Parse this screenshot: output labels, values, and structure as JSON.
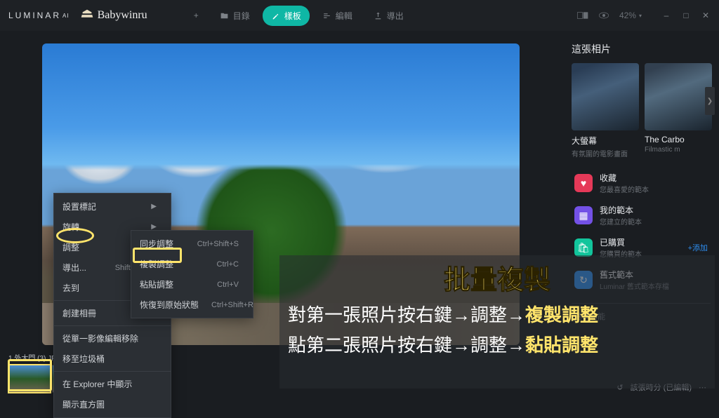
{
  "header": {
    "brand": "LUMINAR",
    "brand_sup": "AI",
    "annotation_signature": "Babywinru",
    "nav": {
      "add": "+",
      "catalog": "目錄",
      "templates": "樣板",
      "edit": "編輯",
      "export": "導出"
    },
    "right": {
      "zoom": "42%",
      "minimize": "–",
      "maximize": "□",
      "close": "✕"
    }
  },
  "ctx_menu_1": [
    {
      "label": "設置標記",
      "arrow": true
    },
    {
      "label": "旋轉",
      "arrow": true
    },
    {
      "label": "調整",
      "arrow": true,
      "highlight": true
    },
    {
      "label": "導出...",
      "shortcut": "Shift+Ctrl+E"
    },
    {
      "label": "去到",
      "arrow": true
    },
    {
      "label": "創建相冊"
    },
    {
      "label": "從單一影像編輯移除"
    },
    {
      "label": "移至垃圾桶"
    },
    {
      "label": "在 Explorer 中顯示"
    },
    {
      "label": "顯示直方圖"
    }
  ],
  "ctx_menu_2": [
    {
      "label": "同步調整",
      "shortcut": "Ctrl+Shift+S"
    },
    {
      "label": "複製調整",
      "shortcut": "Ctrl+C",
      "highlight": true
    },
    {
      "label": "粘貼調整",
      "shortcut": "Ctrl+V"
    },
    {
      "label": "恢復到原始狀態",
      "shortcut": "Ctrl+Shift+R"
    }
  ],
  "filmstrip": {
    "filename": "1.外大門 (3).JP"
  },
  "sidebar": {
    "title": "這張相片",
    "presets": [
      {
        "title": "大螢幕",
        "sub": "有氛圍的電影畫面"
      },
      {
        "title": "The Carbo",
        "sub": "Filmastic m"
      }
    ],
    "categories": [
      {
        "icon": "heart",
        "title": "收藏",
        "sub": "您最喜愛的範本",
        "color": "ci-red"
      },
      {
        "icon": "grid",
        "title": "我的範本",
        "sub": "您建立的範本",
        "color": "ci-purple"
      },
      {
        "icon": "bag",
        "title": "已購買",
        "sub": "您購買的範本",
        "color": "ci-teal",
        "add": "+添加"
      },
      {
        "icon": "clock",
        "title": "舊式範本",
        "sub": "Luminar 舊式範本存檔",
        "color": "ci-blue"
      }
    ],
    "basic_label": "基本功能",
    "bottom_status": "該張時分 (已編輯)"
  },
  "annotation": {
    "title": "批量複製",
    "line1_a": "對第一張照片按右鍵→調整→",
    "line1_b": "複製調整",
    "line2_a": "點第二張照片按右鍵→調整→",
    "line2_b": "黏貼調整"
  }
}
